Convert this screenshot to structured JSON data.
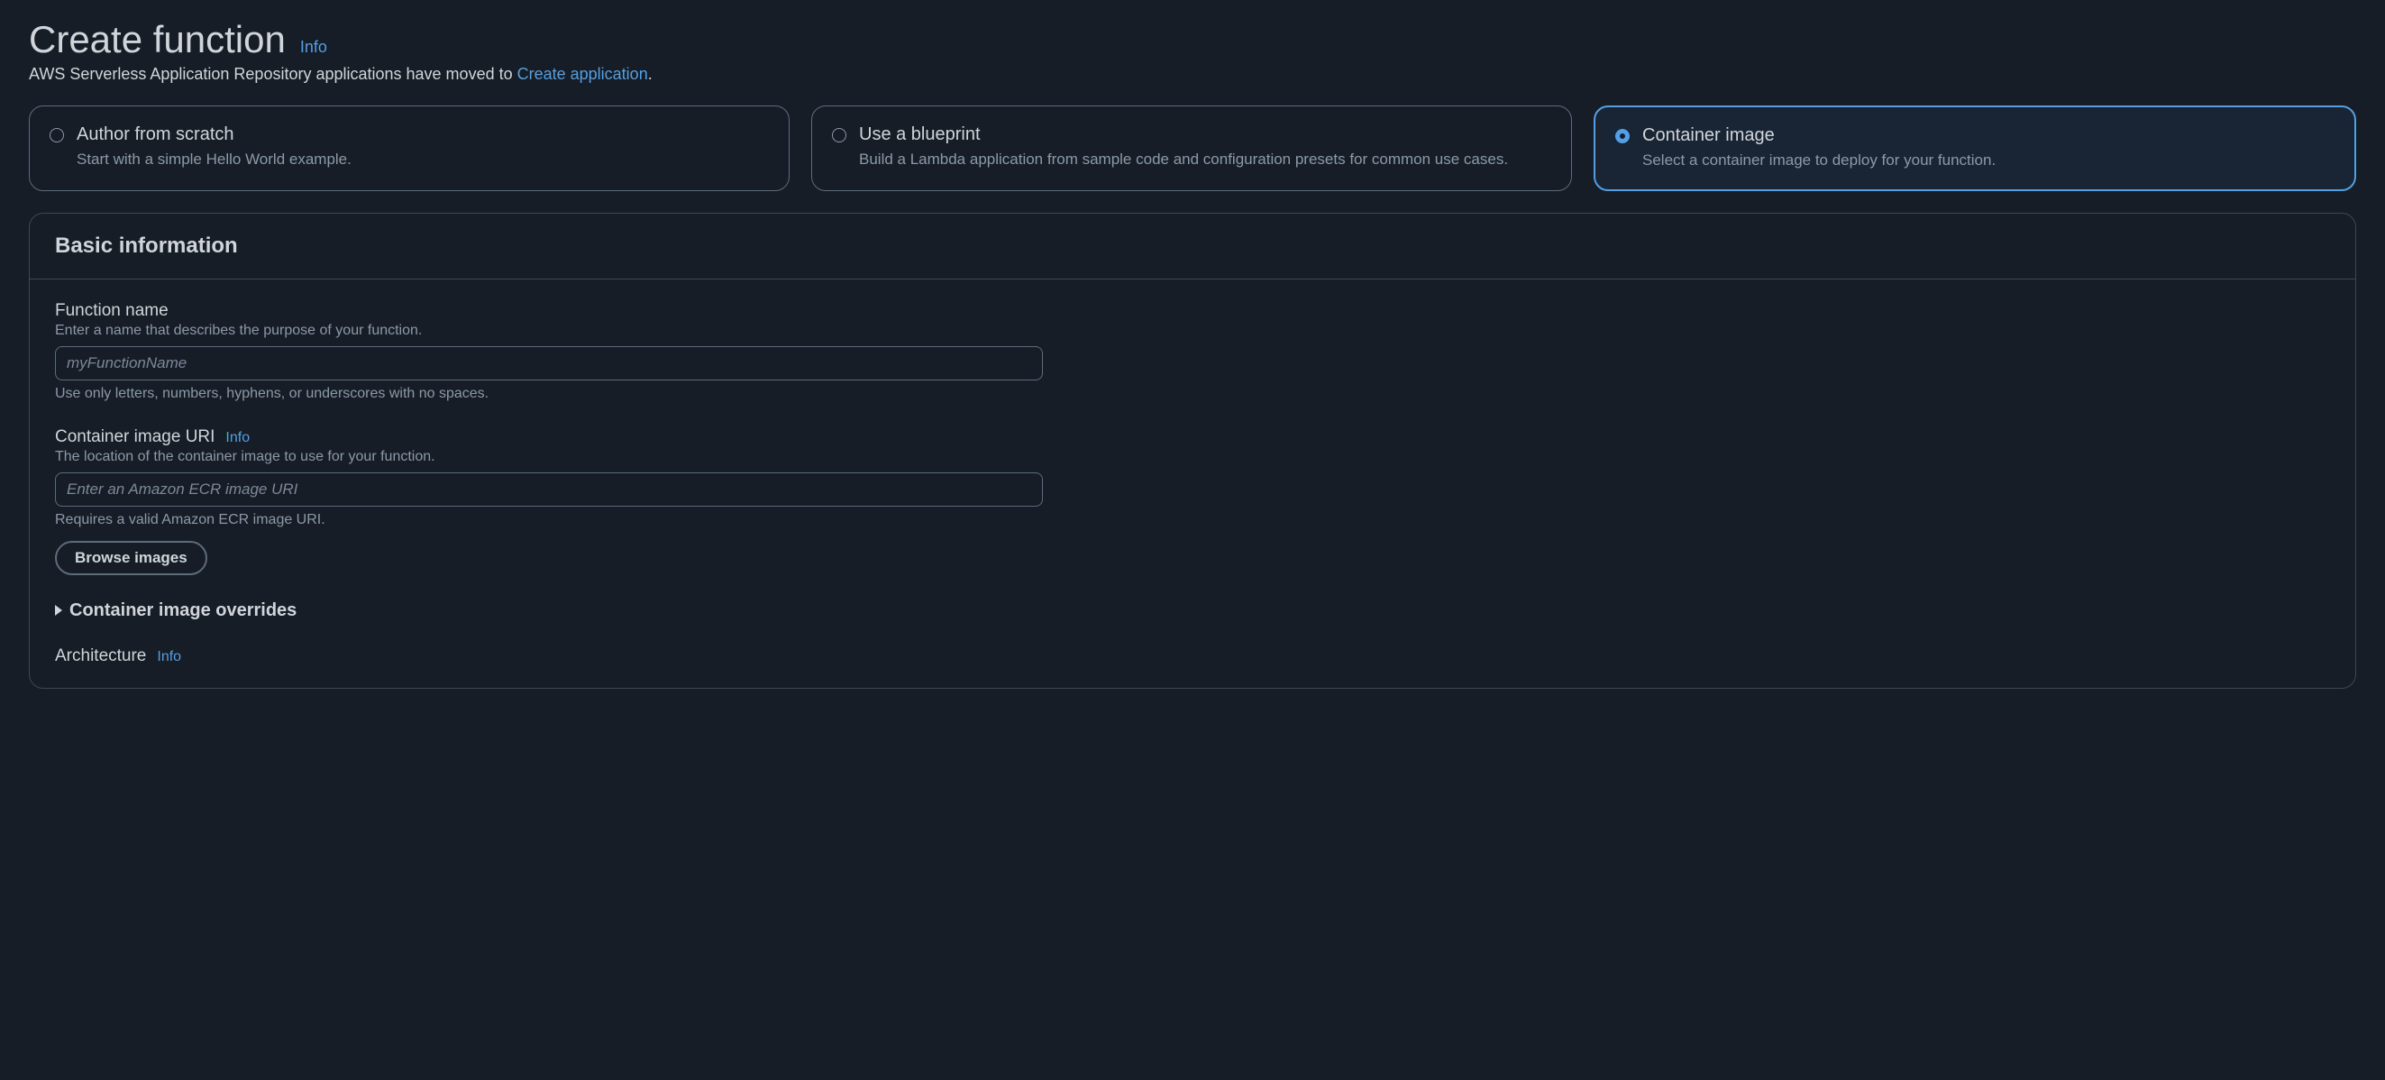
{
  "header": {
    "title": "Create function",
    "info_label": "Info",
    "subtitle_prefix": "AWS Serverless Application Repository applications have moved to ",
    "subtitle_link": "Create application",
    "subtitle_suffix": "."
  },
  "options": [
    {
      "title": "Author from scratch",
      "description": "Start with a simple Hello World example.",
      "selected": false
    },
    {
      "title": "Use a blueprint",
      "description": "Build a Lambda application from sample code and configuration presets for common use cases.",
      "selected": false
    },
    {
      "title": "Container image",
      "description": "Select a container image to deploy for your function.",
      "selected": true
    }
  ],
  "panel": {
    "title": "Basic information"
  },
  "form": {
    "function_name": {
      "label": "Function name",
      "description": "Enter a name that describes the purpose of your function.",
      "placeholder": "myFunctionName",
      "value": "",
      "constraint": "Use only letters, numbers, hyphens, or underscores with no spaces."
    },
    "container_uri": {
      "label": "Container image URI",
      "info_label": "Info",
      "description": "The location of the container image to use for your function.",
      "placeholder": "Enter an Amazon ECR image URI",
      "value": "",
      "constraint": "Requires a valid Amazon ECR image URI.",
      "browse_button": "Browse images"
    },
    "overrides": {
      "label": "Container image overrides"
    },
    "architecture": {
      "label": "Architecture",
      "info_label": "Info"
    }
  }
}
